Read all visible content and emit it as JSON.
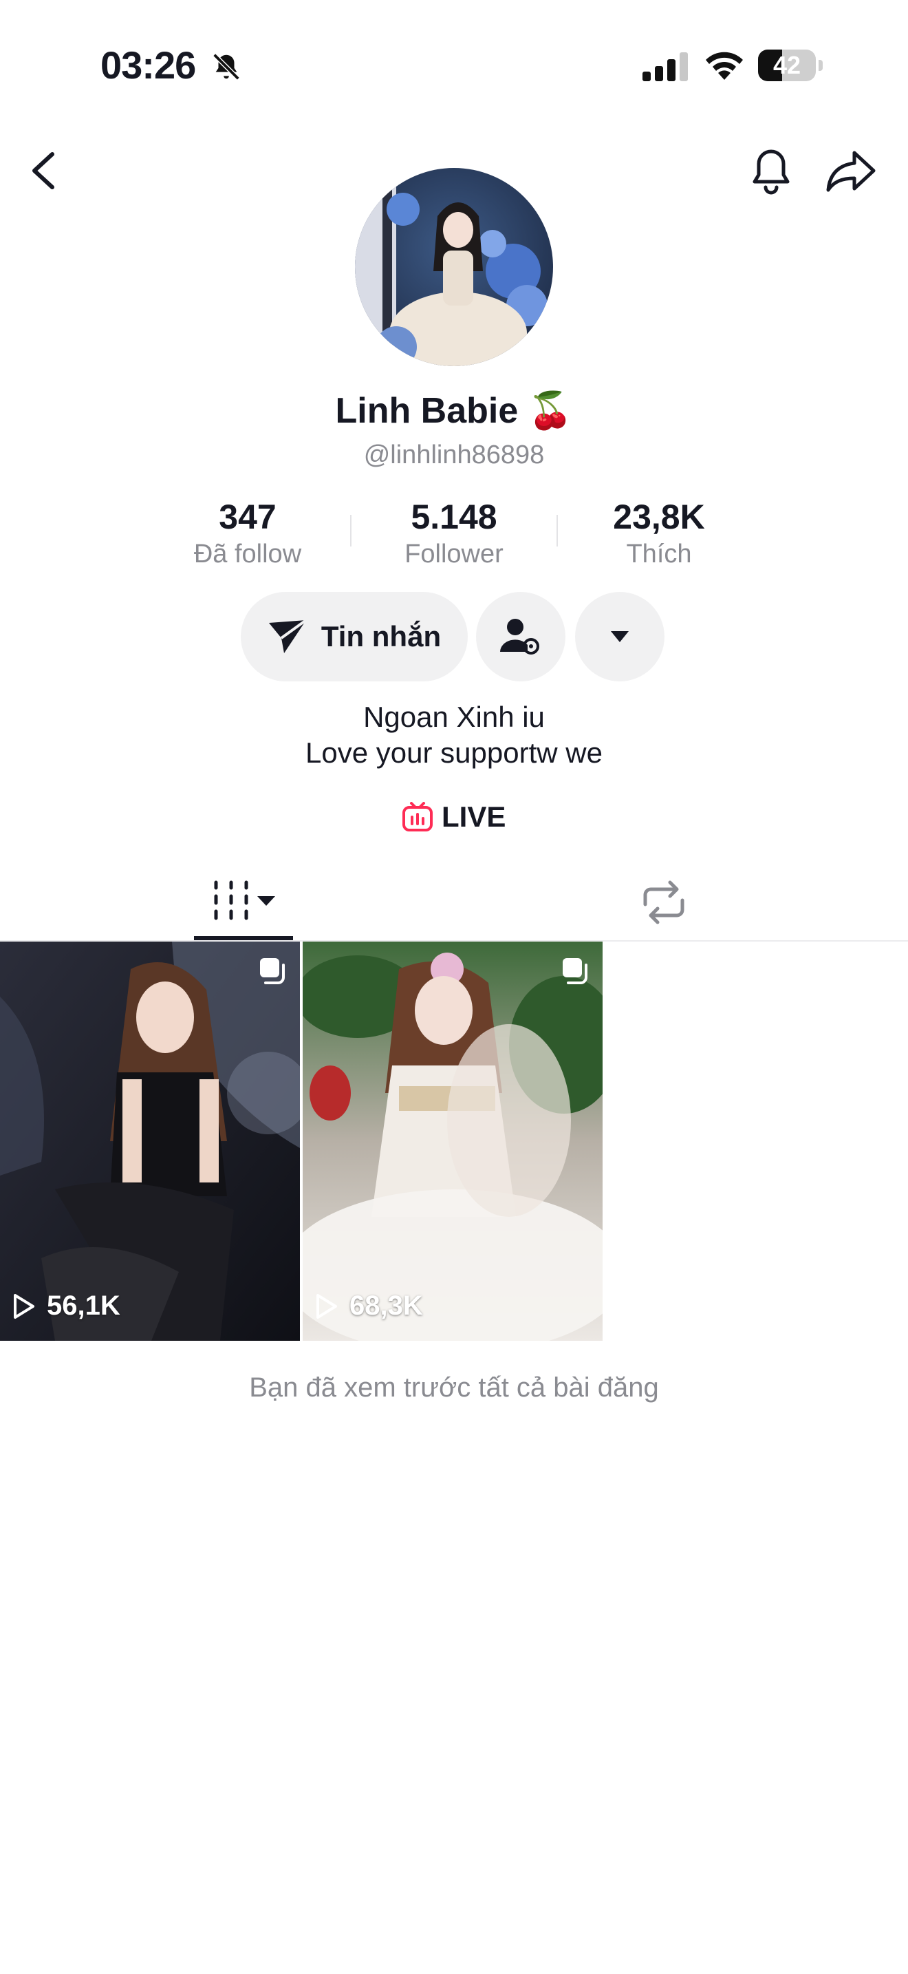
{
  "status_bar": {
    "time": "03:26",
    "battery_level": "42",
    "battery_fraction": 0.42
  },
  "profile": {
    "name": "Linh Babie",
    "name_emoji": "🍒",
    "handle": "@linhlinh86898",
    "stats": [
      {
        "value": "347",
        "label": "Đã follow"
      },
      {
        "value": "5.148",
        "label": "Follower"
      },
      {
        "value": "23,8K",
        "label": "Thích"
      }
    ],
    "message_button": "Tin nhắn",
    "bio_line1": "Ngoan Xinh iu",
    "bio_line2": "Love your supportw we",
    "live_label": "LIVE"
  },
  "tabs": [
    {
      "name": "videos-tab",
      "icon": "grid-columns-icon",
      "selected": true
    },
    {
      "name": "reposts-tab",
      "icon": "repost-icon",
      "selected": false
    }
  ],
  "videos": [
    {
      "views": "56,1K"
    },
    {
      "views": "68,3K"
    }
  ],
  "footer_text": "Bạn đã xem trước tất cả bài đăng",
  "colors": {
    "live_accent": "#fe2c55",
    "secondary_text": "#8a8b91",
    "button_bg": "#f1f1f2"
  }
}
